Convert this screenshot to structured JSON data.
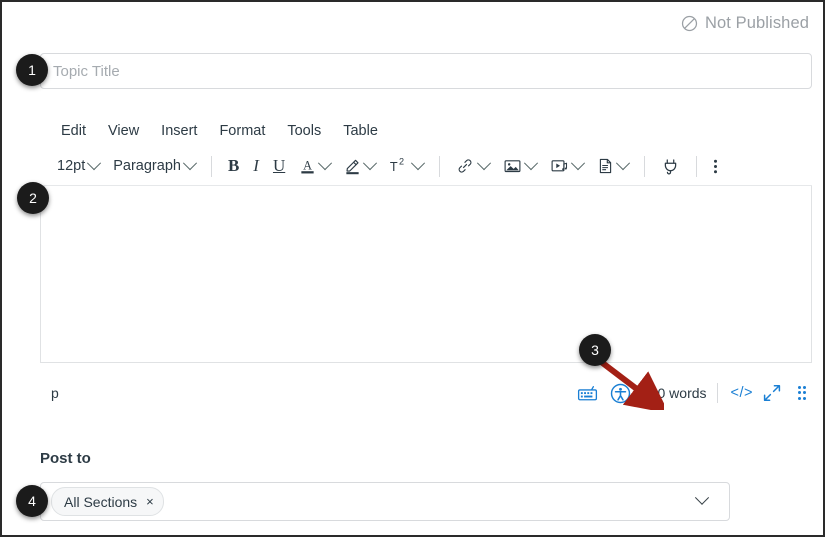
{
  "status": {
    "icon": "not-published-icon",
    "label": "Not Published"
  },
  "title_field": {
    "placeholder": "Topic Title",
    "value": ""
  },
  "editor": {
    "menubar": [
      {
        "label": "Edit"
      },
      {
        "label": "View"
      },
      {
        "label": "Insert"
      },
      {
        "label": "Format"
      },
      {
        "label": "Tools"
      },
      {
        "label": "Table"
      }
    ],
    "toolbar": {
      "font_size": "12pt",
      "block_format": "Paragraph",
      "buttons": [
        {
          "name": "bold",
          "glyph": "B"
        },
        {
          "name": "italic",
          "glyph": "I"
        },
        {
          "name": "underline",
          "glyph": "U"
        },
        {
          "name": "text-color",
          "glyph": "A"
        },
        {
          "name": "highlight-color",
          "glyph": "highlighter-icon"
        },
        {
          "name": "superscript",
          "glyph": "T2"
        },
        {
          "name": "link",
          "glyph": "link-icon"
        },
        {
          "name": "image",
          "glyph": "image-icon"
        },
        {
          "name": "media",
          "glyph": "media-icon"
        },
        {
          "name": "document",
          "glyph": "document-icon"
        },
        {
          "name": "apps",
          "glyph": "plug-icon"
        },
        {
          "name": "more",
          "glyph": "kebab-icon"
        }
      ]
    },
    "body_text": ""
  },
  "statusbar": {
    "element_path": "p",
    "keyboard_icon": "keyboard-shortcuts-icon",
    "a11y_icon": "accessibility-checker-icon",
    "word_count": "0 words",
    "html_editor": "</>",
    "fullscreen_icon": "fullscreen-icon",
    "resize_icon": "resize-grip-icon"
  },
  "post_to": {
    "label": "Post to",
    "selected": [
      {
        "label": "All Sections",
        "remove": "×"
      }
    ],
    "chevron": "chevron-down-icon"
  },
  "callouts": [
    {
      "number": "1",
      "target": "topic-title-input"
    },
    {
      "number": "2",
      "target": "editor-content-area"
    },
    {
      "number": "3",
      "target": "word-count"
    },
    {
      "number": "4",
      "target": "post-to-select"
    }
  ],
  "colors": {
    "accent_blue": "#1a7fd4",
    "arrow_red": "#a32015",
    "text": "#2d3b45",
    "muted": "#9ba0a5"
  }
}
